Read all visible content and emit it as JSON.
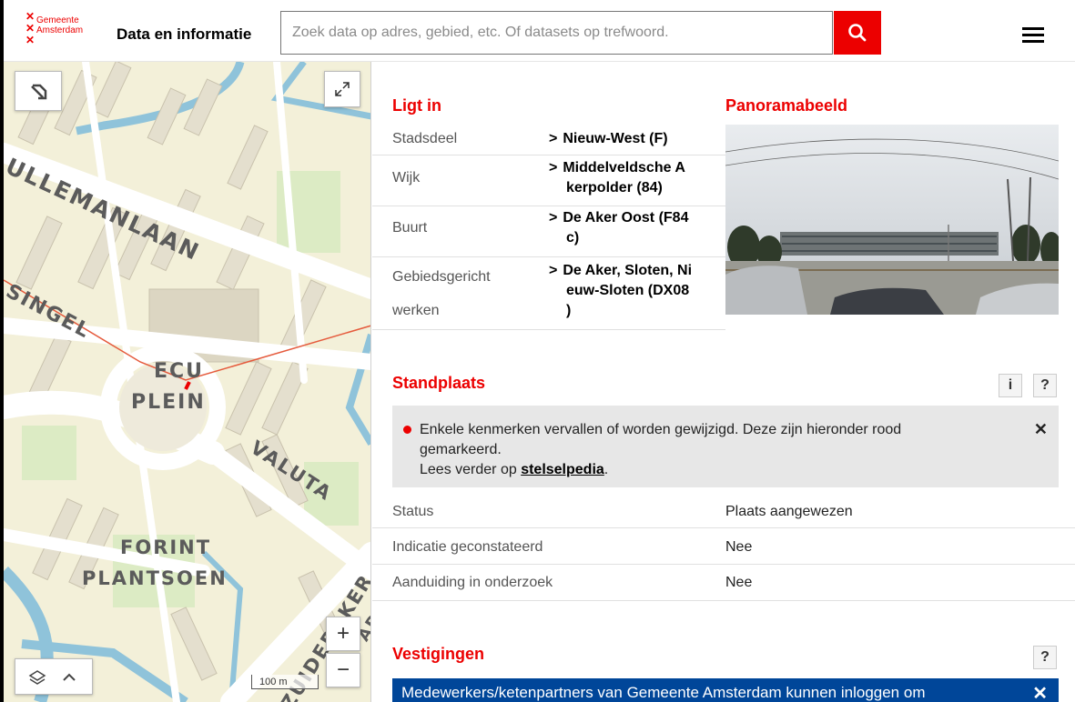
{
  "header": {
    "logo_line1": "Gemeente",
    "logo_line2": "Amsterdam",
    "title": "Data en informatie",
    "search_placeholder": "Zoek data op adres, gebied, etc. Of datasets op trefwoord.",
    "search_icon": "search-icon",
    "menu_icon": "hamburger-menu-icon"
  },
  "map": {
    "labels": {
      "street1": "ULLEMANLAAN",
      "street2": "SINGEL",
      "plein1": "ECU",
      "plein2": "PLEIN",
      "valuta": "VALUTA",
      "forint": "FORINT",
      "plantsoen": "PLANTSOEN",
      "zuideraker": "ZUIDERAKER",
      "ad": "AD"
    },
    "scale_label": "100 m",
    "zoom_in": "+",
    "zoom_out": "−"
  },
  "ligt_in": {
    "title": "Ligt in",
    "rows": [
      {
        "label": "Stadsdeel",
        "value_lines": [
          "Nieuw-West (F)"
        ]
      },
      {
        "label": "Wijk",
        "value_lines": [
          "Middelveldsche A",
          "kerpolder (84)"
        ]
      },
      {
        "label": "Buurt",
        "value_lines": [
          "De Aker Oost (F84",
          "c)"
        ]
      },
      {
        "label_lines": [
          "Gebiedsgericht",
          "werken"
        ],
        "value_lines": [
          "De Aker, Sloten, Ni",
          "euw-Sloten (DX08",
          ")"
        ]
      }
    ]
  },
  "panorama": {
    "title": "Panoramabeeld"
  },
  "standplaats": {
    "title": "Standplaats",
    "info_btn": "i",
    "help_btn": "?",
    "notice_line1": "Enkele kenmerken vervallen of worden gewijzigd. Deze zijn hieronder rood",
    "notice_line2": "gemarkeerd.",
    "notice_line3_prefix": "Lees verder op ",
    "notice_link": "stelselpedia",
    "notice_line3_suffix": ".",
    "notice_close": "✕",
    "rows": [
      {
        "label": "Status",
        "value": "Plaats aangewezen"
      },
      {
        "label": "Indicatie geconstateerd",
        "value": "Nee"
      },
      {
        "label": "Aanduiding in onderzoek",
        "value": "Nee"
      }
    ]
  },
  "vestigingen": {
    "title": "Vestigingen",
    "help_btn": "?",
    "banner_text": "Medewerkers/ketenpartners van Gemeente Amsterdam kunnen inloggen om",
    "banner_close": "✕"
  },
  "colors": {
    "brand_red": "#ec0000",
    "brand_blue": "#004699"
  }
}
